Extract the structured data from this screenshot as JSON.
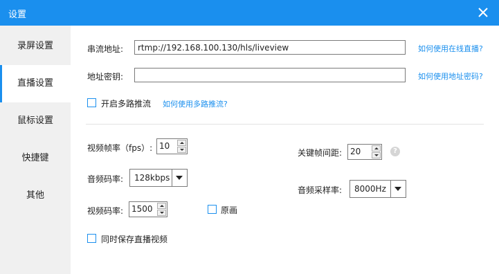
{
  "window": {
    "title": "设置"
  },
  "sidebar": {
    "items": [
      {
        "label": "录屏设置"
      },
      {
        "label": "直播设置"
      },
      {
        "label": "鼠标设置"
      },
      {
        "label": "快捷键"
      },
      {
        "label": "其他"
      }
    ],
    "active_index": 1
  },
  "stream": {
    "url_label": "串流地址:",
    "url_value": "rtmp://192.168.100.130/hls/liveview",
    "url_help": "如何使用在线直播?",
    "key_label": "地址密钥:",
    "key_value": "",
    "key_help": "如何使用地址密码?",
    "multi_label": "开启多路推流",
    "multi_help": "如何使用多路推流?"
  },
  "video": {
    "fps_label": "视频帧率（fps）:",
    "fps_value": "10",
    "keyframe_label": "关键帧间距:",
    "keyframe_value": "20",
    "audio_bitrate_label": "音频码率:",
    "audio_bitrate_value": "128kbps",
    "audio_sample_label": "音频采样率:",
    "audio_sample_value": "8000Hz",
    "video_bitrate_label": "视频码率:",
    "video_bitrate_value": "1500",
    "original_label": "原画",
    "save_label": "同时保存直播视频"
  },
  "colors": {
    "accent": "#1a8fee",
    "sidebar_bg": "#f0f0f0"
  },
  "icons": {
    "close": "close-icon",
    "help": "help-icon"
  },
  "help_glyph": "?"
}
